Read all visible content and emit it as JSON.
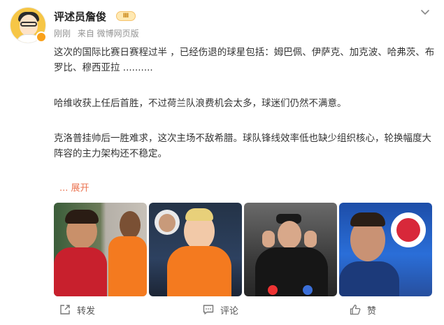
{
  "post": {
    "author": "评述员詹俊",
    "level_badge": "Ⅲ",
    "time": "刚刚",
    "source": "来自 微博网页版",
    "paragraphs": [
      "这次的国际比赛日赛程过半 ，已经伤退的球星包括：姆巴佩、伊萨克、加克波、哈弗茨、布罗比、穆西亚拉 ..........",
      "哈维收获上任后首胜，不过荷兰队浪费机会太多，球迷们仍然不满意。",
      "克洛普挂帅后一胜难求，这次主场不敌希腊。球队锋线效率低也缺少组织核心，轮换幅度大阵容的主力架构还不稳定。"
    ],
    "expand_label": "... 展开"
  },
  "actions": {
    "repost": "转发",
    "comment": "评论",
    "like": "赞"
  },
  "colors": {
    "accent": "#eb7350",
    "text": "#333333",
    "meta": "#939393"
  },
  "icons": {
    "menu": "chevron-down-icon",
    "repost": "repost-icon",
    "comment": "comment-icon",
    "like": "thumb-up-icon"
  }
}
